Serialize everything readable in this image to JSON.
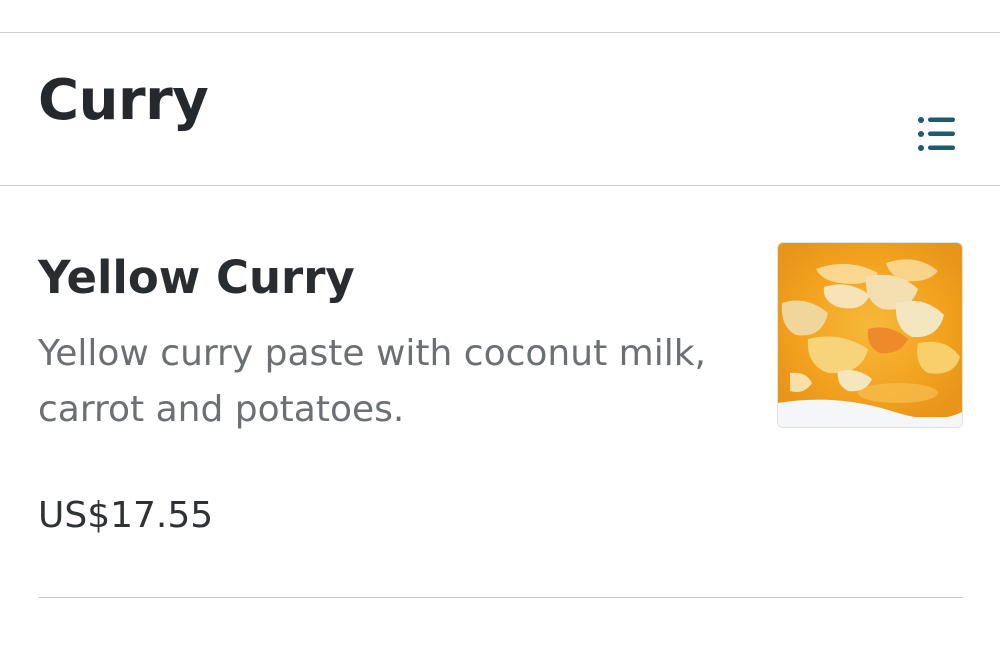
{
  "section": {
    "title": "Curry",
    "list_icon": "list-icon"
  },
  "item": {
    "name": "Yellow Curry",
    "description": "Yellow curry paste with coconut milk, carrot and potatoes.",
    "price": "US$17.55",
    "photo_icon": "curry-photo"
  },
  "colors": {
    "accent": "#1f5a73",
    "title": "#26292c",
    "description": "#6d7073",
    "divider": "#cfcfcf"
  }
}
